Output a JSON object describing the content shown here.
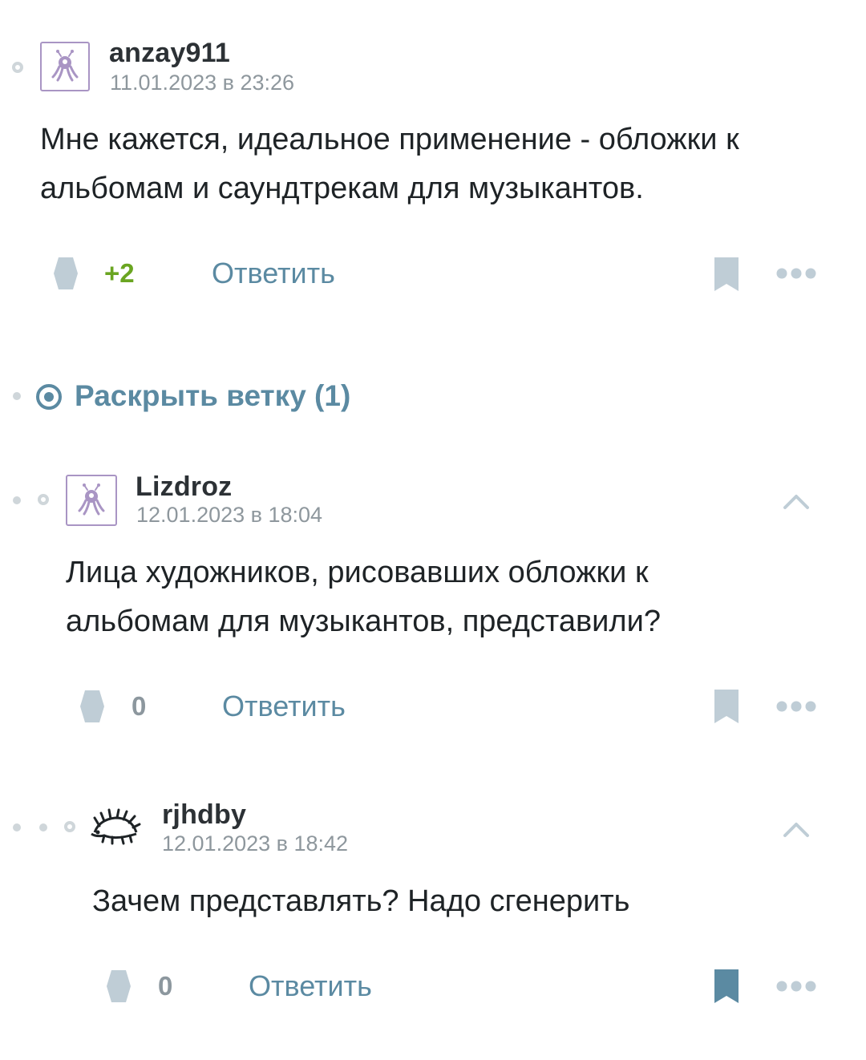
{
  "comments": [
    {
      "username": "anzay911",
      "date": "11.01.2023 в 23:26",
      "text_lines": [
        "Мне кажется, идеальное применение - обложки к",
        "альбомам и саундтрекам для музыкантов."
      ],
      "score": "+2",
      "score_color": "#6aa521",
      "reply_label": "Ответить",
      "bookmarked": false
    },
    {
      "username": "Lizdroz",
      "date": "12.01.2023 в 18:04",
      "text_lines": [
        "Лица художников, рисовавших обложки к",
        "альбомам для музыкантов, представили?"
      ],
      "score": "0",
      "score_color": "#8c979e",
      "reply_label": "Ответить",
      "bookmarked": false
    },
    {
      "username": "rjhdby",
      "date": "12.01.2023 в 18:42",
      "text_lines": [
        "Зачем представлять? Надо сгенерить"
      ],
      "score": "0",
      "score_color": "#8c979e",
      "reply_label": "Ответить",
      "bookmarked": true
    }
  ],
  "expand_thread": {
    "label": "Раскрыть ветку (1)"
  },
  "icons": {
    "vote": "vote-diamond-icon",
    "bookmark": "bookmark-icon",
    "more": "more-dots-icon",
    "collapse": "chevron-up-icon",
    "expand": "target-circle-icon"
  },
  "colors": {
    "accent": "#5b8aa2",
    "icon_muted": "#bfcdd6",
    "bookmark_active": "#5b8aa2",
    "avatar_border": "#a995c4"
  }
}
